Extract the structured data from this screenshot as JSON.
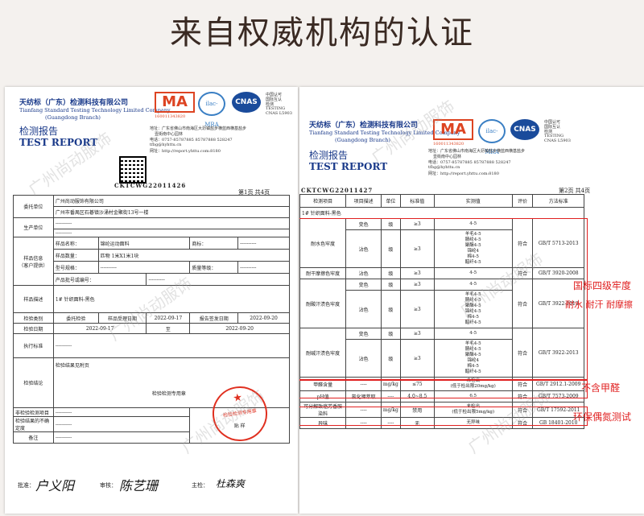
{
  "headline": "来自权威机构的认证",
  "common": {
    "company_cn": "天纺标（广东）检测科技有限公司",
    "company_en": "Tianfang Standard Testing Technology Limited Company",
    "branch": "(Guangdong Branch)",
    "report_cn": "检测报告",
    "report_en": "TEST REPORT",
    "ma": "MA",
    "ma_no": "160011343820",
    "ilac": "ilac-MRA",
    "cnas": "CNAS",
    "cnas_no": "CNAS L5903",
    "cnas_text1": "中国认可",
    "cnas_text2": "国际互认",
    "cnas_text3": "检测",
    "cnas_text4": "TESTING",
    "address": "地址：广东省佛山市南海区大沥镇盐步横蓝西横基盐步",
    "address2": "壹街南中心园林",
    "tel": "电话：0757-85787885 85787888  528247",
    "email": "tfbg@hyhttu.cn",
    "web": "网址：http://report.yhttu.com:8180",
    "code": "CKTCWG22011426",
    "code2": "CKTCWG22011427",
    "watermark": "广州尚动服饰"
  },
  "page1": {
    "page_label": "第1页  共4页",
    "rows": {
      "client_label": "委托单位",
      "client_name": "广州尚动服饰有限公司",
      "client_addr": "广州市番禺区石碁镇沙涌村金聚街13号一楼",
      "producer_label": "生产单位",
      "producer_value": "----------",
      "producer_value2": "----------",
      "sample_label": "样品信息\n（客户提供）",
      "sample_name_label": "样品名称：",
      "sample_name": "锦纶运动面料",
      "trademark_label": "商标：",
      "trademark": "----------",
      "sample_qty_label": "样品数量：",
      "sample_qty": "匹物 1米X1米1块",
      "model_label": "型号规格：",
      "model": "----------",
      "grade_label": "质量等级：",
      "grade": "----------",
      "prod_no_label": "产品批号或编号：",
      "prod_no": "----------",
      "desc_label": "样品描述",
      "desc": "1# 针织面料-黑色",
      "inspect_type_label": "检验类别",
      "inspect_type": "委托检验",
      "accept_date_label": "样品受理日期",
      "accept_date": "2022-09-17",
      "report_date_label": "报告签发日期",
      "report_date": "2022-09-20",
      "inspect_date_label": "检验日期",
      "inspect_from": "2022-09-17",
      "to": "至",
      "inspect_to": "2022-09-20",
      "standard_label": "执行标准",
      "standard": "----------",
      "conclusion_label": "检验结论",
      "conclusion": "检验结果见附页",
      "stamp_label": "检验检测专用章",
      "seal_label": "检验检测专用章",
      "non_label": "非检验检测项目",
      "non_value": "----------",
      "out_label": "检验结果的不确定度",
      "out_value": "----------",
      "note_label": "备注",
      "note_value": "----------",
      "paste_label": "贴   样"
    },
    "sign": {
      "approve_label": "批准：",
      "approve_sig": "户义阳",
      "review_label": "审核：",
      "review_sig": "陈艺珊",
      "prepare_label": "主检：",
      "prepare_sig": "杜森爽"
    }
  },
  "page2": {
    "page_label": "第2页  共4页",
    "headers": [
      "检测项目",
      "项目描述",
      "单位",
      "标准值",
      "实测值",
      "评价",
      "方法标准"
    ],
    "sample_desc": "1#  针织面料-黑色",
    "groups": [
      {
        "item": "耐水色牢度",
        "rows": [
          {
            "desc": "变色",
            "unit": "级",
            "std": "≥3",
            "val": "4-5"
          },
          {
            "desc": "沾色",
            "unit": "级",
            "std": "≥3",
            "val": "羊毛4-5\n腈纶4-5\n聚酯4-5\n锦纶4\n棉4-5\n醋纤4-5"
          }
        ],
        "eval": "符合",
        "method": "GB/T 5713-2013"
      },
      {
        "item": "耐干摩擦色牢度",
        "rows": [
          {
            "desc": "沾色",
            "unit": "级",
            "std": "≥3",
            "val": "4-5"
          }
        ],
        "eval": "符合",
        "method": "GB/T 3920-2008"
      },
      {
        "item": "耐酸汗渍色牢度",
        "rows": [
          {
            "desc": "变色",
            "unit": "级",
            "std": "≥3",
            "val": "4-5"
          },
          {
            "desc": "沾色",
            "unit": "级",
            "std": "≥3",
            "val": "羊毛4-5\n腈纶4-5\n聚酯4-5\n锦纶4-5\n棉4-5\n醋纤4-5"
          }
        ],
        "eval": "符合",
        "method": "GB/T 3922-2013"
      },
      {
        "item": "耐碱汗渍色牢度",
        "rows": [
          {
            "desc": "变色",
            "unit": "级",
            "std": "≥3",
            "val": "4-5"
          },
          {
            "desc": "沾色",
            "unit": "级",
            "std": "≥3",
            "val": "羊毛4-5\n腈纶4-5\n聚酯4-5\n锦纶4\n棉4-5\n醋纤4-5"
          }
        ],
        "eval": "符合",
        "method": "GB/T 3922-2013"
      },
      {
        "item": "甲醛含量",
        "rows": [
          {
            "desc": "----",
            "unit": "mg/kg",
            "std": "≤75",
            "val": "未检出\n(低于检出限20mg/kg)"
          }
        ],
        "eval": "符合",
        "method": "GB/T 2912.1-2009"
      },
      {
        "item": "pH值",
        "rows": [
          {
            "desc": "氯化钾萃取",
            "unit": "----",
            "std": "4.0~8.5",
            "val": "6.5"
          }
        ],
        "eval": "符合",
        "method": "GB/T 7573-2009"
      },
      {
        "item": "可分解致癌芳香胺染料",
        "rows": [
          {
            "desc": "----",
            "unit": "mg/kg",
            "std": "禁用",
            "val": "未检出\n(低于检出限5mg/kg)"
          }
        ],
        "eval": "符合",
        "method": "GB/T 17592-2011"
      },
      {
        "item": "异味",
        "rows": [
          {
            "desc": "----",
            "unit": "----",
            "std": "无",
            "val": "无异味"
          }
        ],
        "eval": "符合",
        "method": "GB 18401-2010"
      }
    ]
  },
  "annotations": {
    "grade": "国标四级牢度",
    "resist": "耐水 耐汗 耐摩擦",
    "no_formaldehyde": "不含甲醛",
    "azo": "环保偶氮测试"
  },
  "colors": {
    "accent_red": "#e02020",
    "brand_blue": "#1a3a8a",
    "title_brown": "#3a2a23"
  }
}
